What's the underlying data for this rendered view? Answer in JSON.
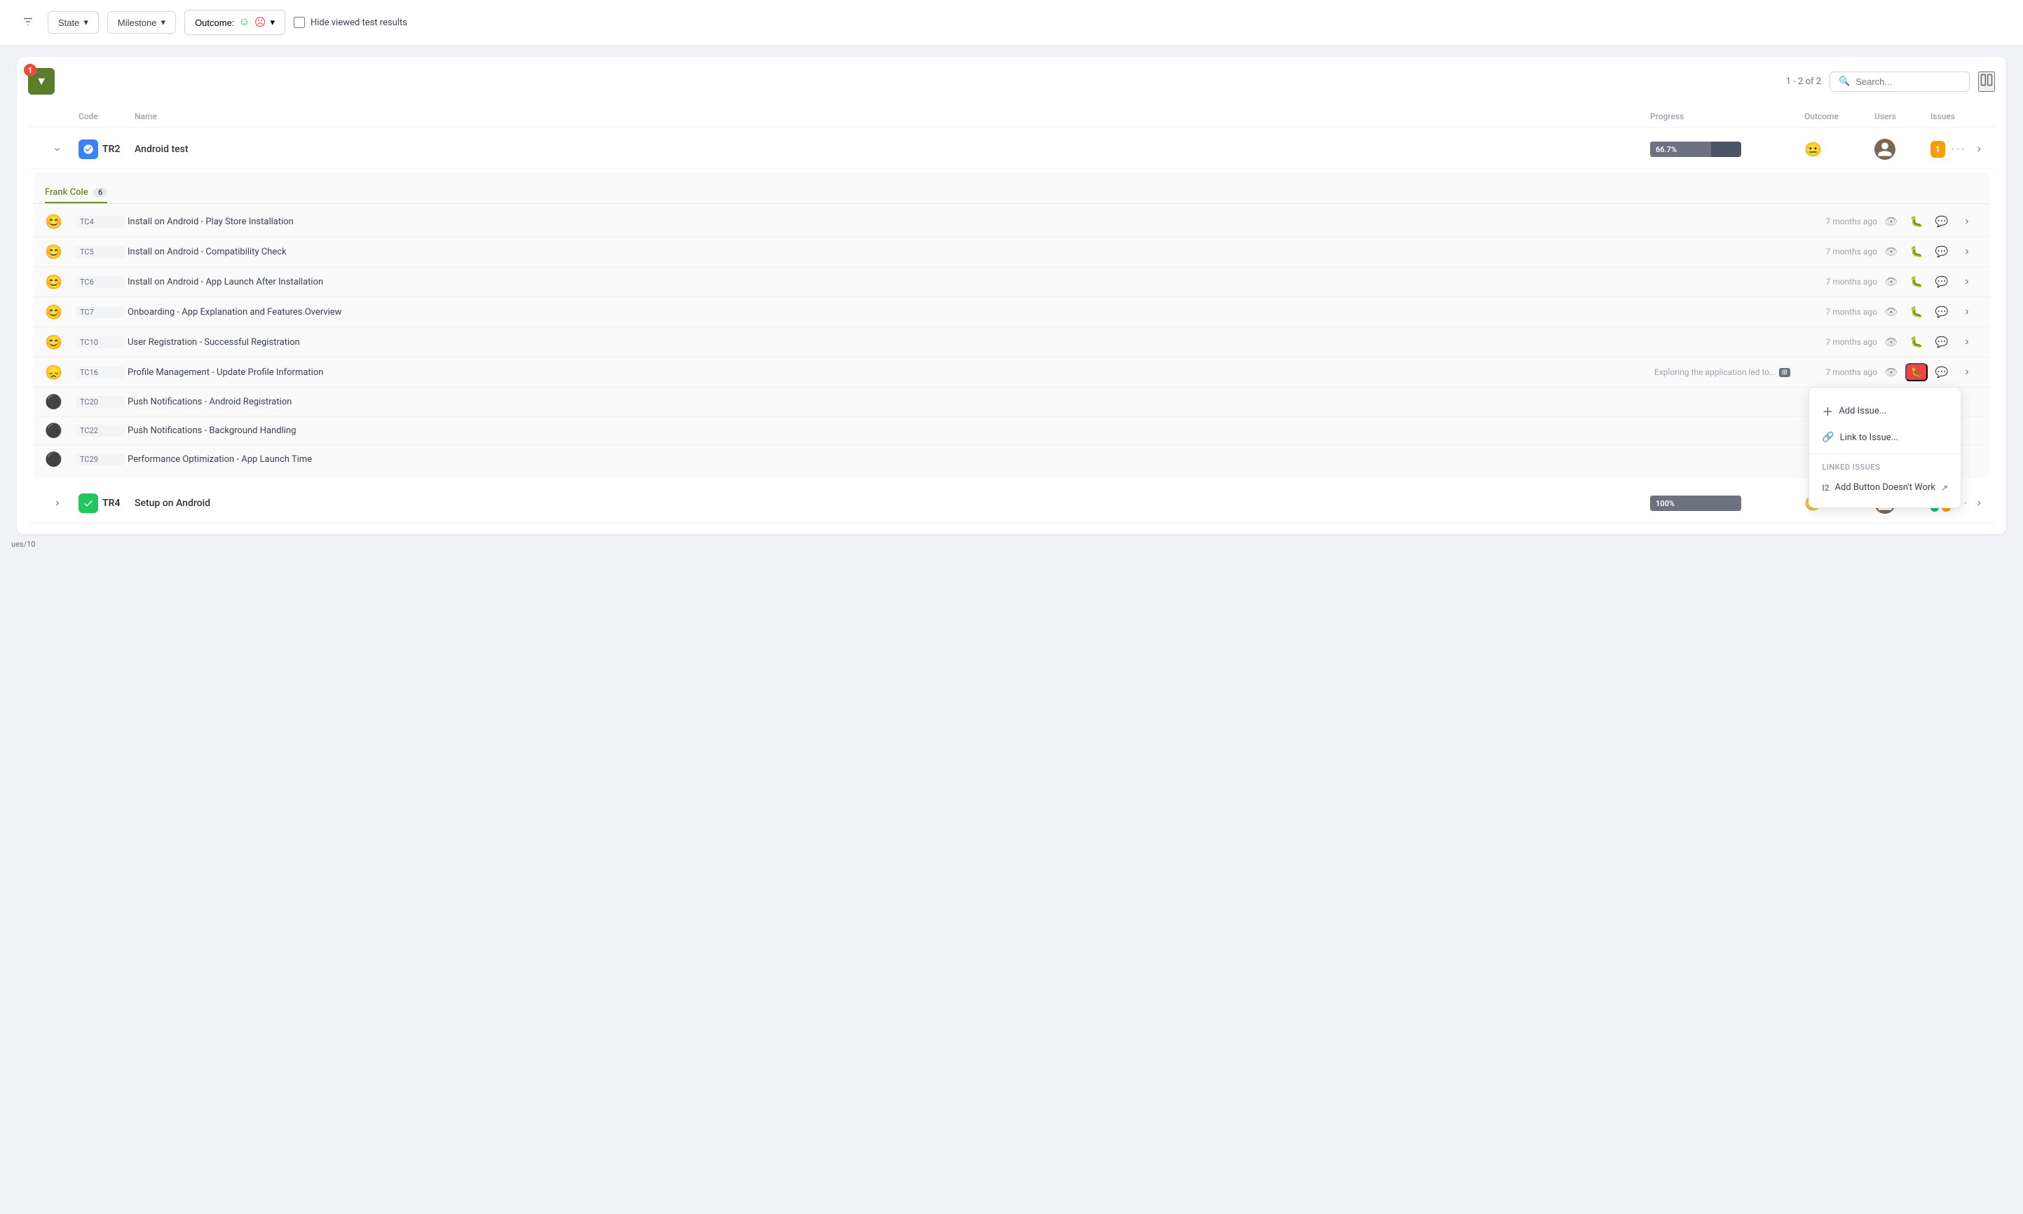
{
  "topbar": {
    "state_label": "State",
    "milestone_label": "Milestone",
    "outcome_label": "Outcome:",
    "hide_label": "Hide viewed test results"
  },
  "panel": {
    "filter_badge": "1",
    "pagination": "1 - 2 of 2",
    "search_placeholder": "Search...",
    "columns": {
      "code": "Code",
      "name": "Name",
      "progress": "Progress",
      "outcome": "Outcome",
      "users": "Users",
      "issues": "Issues"
    }
  },
  "test_runs": [
    {
      "id": "TR2",
      "name": "Android test",
      "progress_pct": 66.7,
      "progress_label": "66.7%",
      "outcome": "neutral",
      "issues_count": "1",
      "expanded": true,
      "tester": "Frank Cole",
      "tester_count": 6,
      "test_cases": [
        {
          "code": "TC4",
          "name": "Install on Android - Play Store Installation",
          "outcome": "pass",
          "time": "7 months ago",
          "note": ""
        },
        {
          "code": "TC5",
          "name": "Install on Android - Compatibility Check",
          "outcome": "pass",
          "time": "7 months ago",
          "note": ""
        },
        {
          "code": "TC6",
          "name": "Install on Android - App Launch After Installation",
          "outcome": "pass",
          "time": "7 months ago",
          "note": ""
        },
        {
          "code": "TC7",
          "name": "Onboarding - App Explanation and Features Overview",
          "outcome": "pass",
          "time": "7 months ago",
          "note": ""
        },
        {
          "code": "TC10",
          "name": "User Registration - Successful Registration",
          "outcome": "pass",
          "time": "7 months ago",
          "note": ""
        },
        {
          "code": "TC16",
          "name": "Profile Management - Update Profile Information",
          "outcome": "fail",
          "time": "7 months ago",
          "note": "Exploring the application led to...",
          "has_popup": true
        },
        {
          "code": "TC20",
          "name": "Push Notifications - Android Registration",
          "outcome": "none",
          "time": "",
          "note": ""
        },
        {
          "code": "TC22",
          "name": "Push Notifications - Background Handling",
          "outcome": "none",
          "time": "",
          "note": ""
        },
        {
          "code": "TC29",
          "name": "Performance Optimization - App Launch Time",
          "outcome": "none",
          "time": "",
          "note": ""
        }
      ]
    },
    {
      "id": "TR4",
      "name": "Setup on Android",
      "progress_pct": 100,
      "progress_label": "100%",
      "outcome": "fail",
      "issues_count_green": "1",
      "issues_count_orange": "1",
      "expanded": false
    }
  ],
  "popup": {
    "add_issue": "Add Issue...",
    "link_issue": "Link to Issue...",
    "linked_issues": "Linked issues",
    "issue_id": "I2",
    "issue_name": "Add Button Doesn't Work"
  },
  "footer": {
    "label": "ues/10"
  }
}
